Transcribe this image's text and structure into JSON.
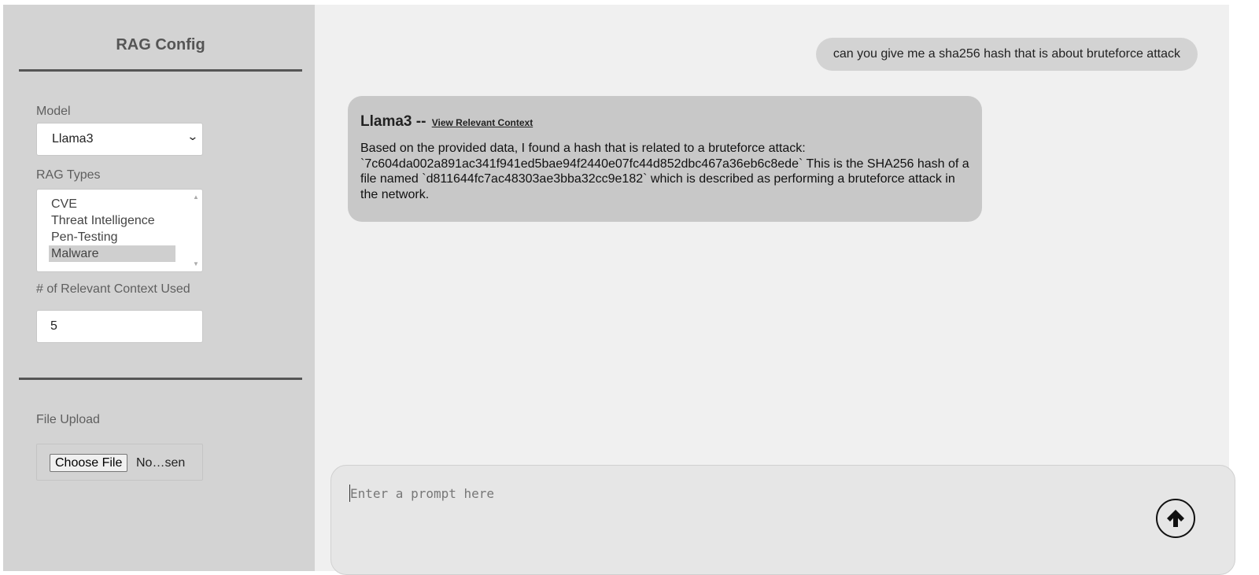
{
  "sidebar": {
    "title": "RAG Config",
    "model_label": "Model",
    "model_value": "Llama3",
    "rag_types_label": "RAG Types",
    "rag_types": [
      "CVE",
      "Threat Intelligence",
      "Pen-Testing",
      "Malware"
    ],
    "rag_types_selected": "Malware",
    "context_label": "# of Relevant Context Used",
    "context_value": "5",
    "file_upload_label": "File Upload",
    "file_button_label": "Choose File",
    "file_status": "No…sen"
  },
  "chat": {
    "user_message": "can you give me a sha256 hash that is about bruteforce attack",
    "bot_name": "Llama3",
    "bot_separator": "--",
    "bot_link": "View Relevant Context",
    "bot_message": "Based on the provided data, I found a hash that is related to a bruteforce attack: `7c604da002a891ac341f941ed5bae94f2440e07fc44d852dbc467a36eb6c8ede` This is the SHA256 hash of a file named `d811644fc7ac48303ae3bba32cc9e182` which is described as performing a bruteforce attack in the network."
  },
  "prompt": {
    "placeholder": "Enter a prompt here",
    "send_icon": "arrow-up-icon"
  },
  "colors": {
    "sidebar_bg": "#d3d3d3",
    "main_bg": "#f0f0f0",
    "bot_bubble": "#c8c8c8",
    "user_bubble": "#d3d3d3"
  }
}
